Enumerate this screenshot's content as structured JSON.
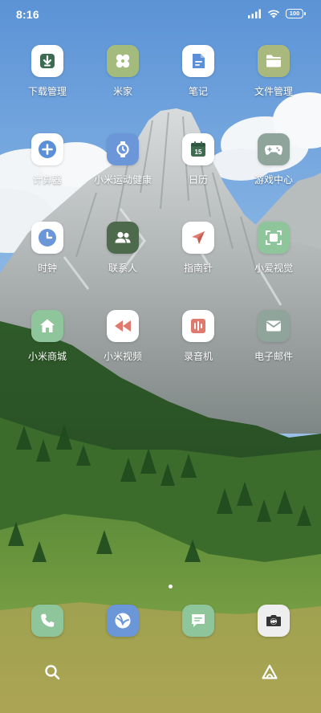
{
  "status_bar": {
    "time": "8:16",
    "battery": "100"
  },
  "apps": [
    {
      "label": "下载管理",
      "icon": "download-icon",
      "bg": "#ffffff",
      "fg": "#3d6b52"
    },
    {
      "label": "米家",
      "icon": "mijia-icon",
      "bg": "#a4bb7e",
      "fg": "#ffffff"
    },
    {
      "label": "笔记",
      "icon": "note-icon",
      "bg": "#ffffff",
      "fg": "#5b8fd8"
    },
    {
      "label": "文件管理",
      "icon": "folder-icon",
      "bg": "#a9b97e",
      "fg": "#ffffff"
    },
    {
      "label": "计算器",
      "icon": "calculator-icon",
      "bg": "#ffffff",
      "fg": "#5b8fd8"
    },
    {
      "label": "小米运动健康",
      "icon": "watch-icon",
      "bg": "#6b97d9",
      "fg": "#ffffff"
    },
    {
      "label": "日历",
      "icon": "calendar-icon",
      "bg": "#ffffff",
      "fg": "#3f6b50"
    },
    {
      "label": "游戏中心",
      "icon": "gamepad-icon",
      "bg": "#8fa49a",
      "fg": "#ffffff"
    },
    {
      "label": "时钟",
      "icon": "clock-icon",
      "bg": "#ffffff",
      "fg": "#6b97d9"
    },
    {
      "label": "联系人",
      "icon": "contacts-icon",
      "bg": "#4d6b4c",
      "fg": "#ffffff"
    },
    {
      "label": "指南针",
      "icon": "compass-icon",
      "bg": "#ffffff",
      "fg": "#e07a6e"
    },
    {
      "label": "小爱视觉",
      "icon": "scan-icon",
      "bg": "#8fc59a",
      "fg": "#ffffff"
    },
    {
      "label": "小米商城",
      "icon": "home-icon",
      "bg": "#8fc59a",
      "fg": "#ffffff"
    },
    {
      "label": "小米视频",
      "icon": "rewind-icon",
      "bg": "#ffffff",
      "fg": "#e07a6e"
    },
    {
      "label": "录音机",
      "icon": "recorder-icon",
      "bg": "#ffffff",
      "fg": "#e07a6e"
    },
    {
      "label": "电子邮件",
      "icon": "mail-icon",
      "bg": "#8fa49a",
      "fg": "#ffffff"
    }
  ],
  "dock": [
    {
      "icon": "phone-icon",
      "bg": "#8fc59a",
      "fg": "#ffffff"
    },
    {
      "icon": "browser-icon",
      "bg": "#6b97d9",
      "fg": "#ffffff"
    },
    {
      "icon": "messages-icon",
      "bg": "#8fc59a",
      "fg": "#ffffff"
    },
    {
      "icon": "camera-icon",
      "bg": "#eeeeee",
      "fg": "#333333"
    }
  ],
  "bottom_bar": {
    "left_icon": "search-icon",
    "right_icon": "assistant-icon"
  }
}
